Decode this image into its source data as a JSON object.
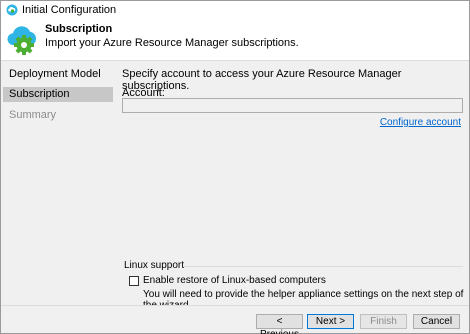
{
  "window": {
    "title": "Initial Configuration"
  },
  "header": {
    "title": "Subscription",
    "subtitle": "Import your Azure Resource Manager subscriptions."
  },
  "sidebar": {
    "items": [
      {
        "label": "Deployment Model",
        "state": "normal"
      },
      {
        "label": "Subscription",
        "state": "selected"
      },
      {
        "label": "Summary",
        "state": "disabled"
      }
    ]
  },
  "main": {
    "instruction": "Specify account to access your Azure Resource Manager subscriptions.",
    "account_label": "Account:",
    "account_value": "",
    "configure_link": "Configure account",
    "linux": {
      "section_label": "Linux support",
      "checkbox_label": "Enable restore of Linux-based computers",
      "checked": false,
      "note": "You will need to provide the helper appliance settings on the next step of the wizard."
    }
  },
  "footer": {
    "previous_label": "< Previous",
    "next_label": "Next >",
    "finish_label": "Finish",
    "cancel_label": "Cancel"
  },
  "colors": {
    "accent": "#0078d7",
    "link": "#0066cc",
    "selected_bg": "#c7c7c7",
    "panel_bg": "#f0f0f0",
    "icon_cloud": "#2fb4e6",
    "icon_gear": "#4caf32"
  },
  "icons": {
    "title": "app-cloud-icon",
    "header": "cloud-gear-icon"
  }
}
